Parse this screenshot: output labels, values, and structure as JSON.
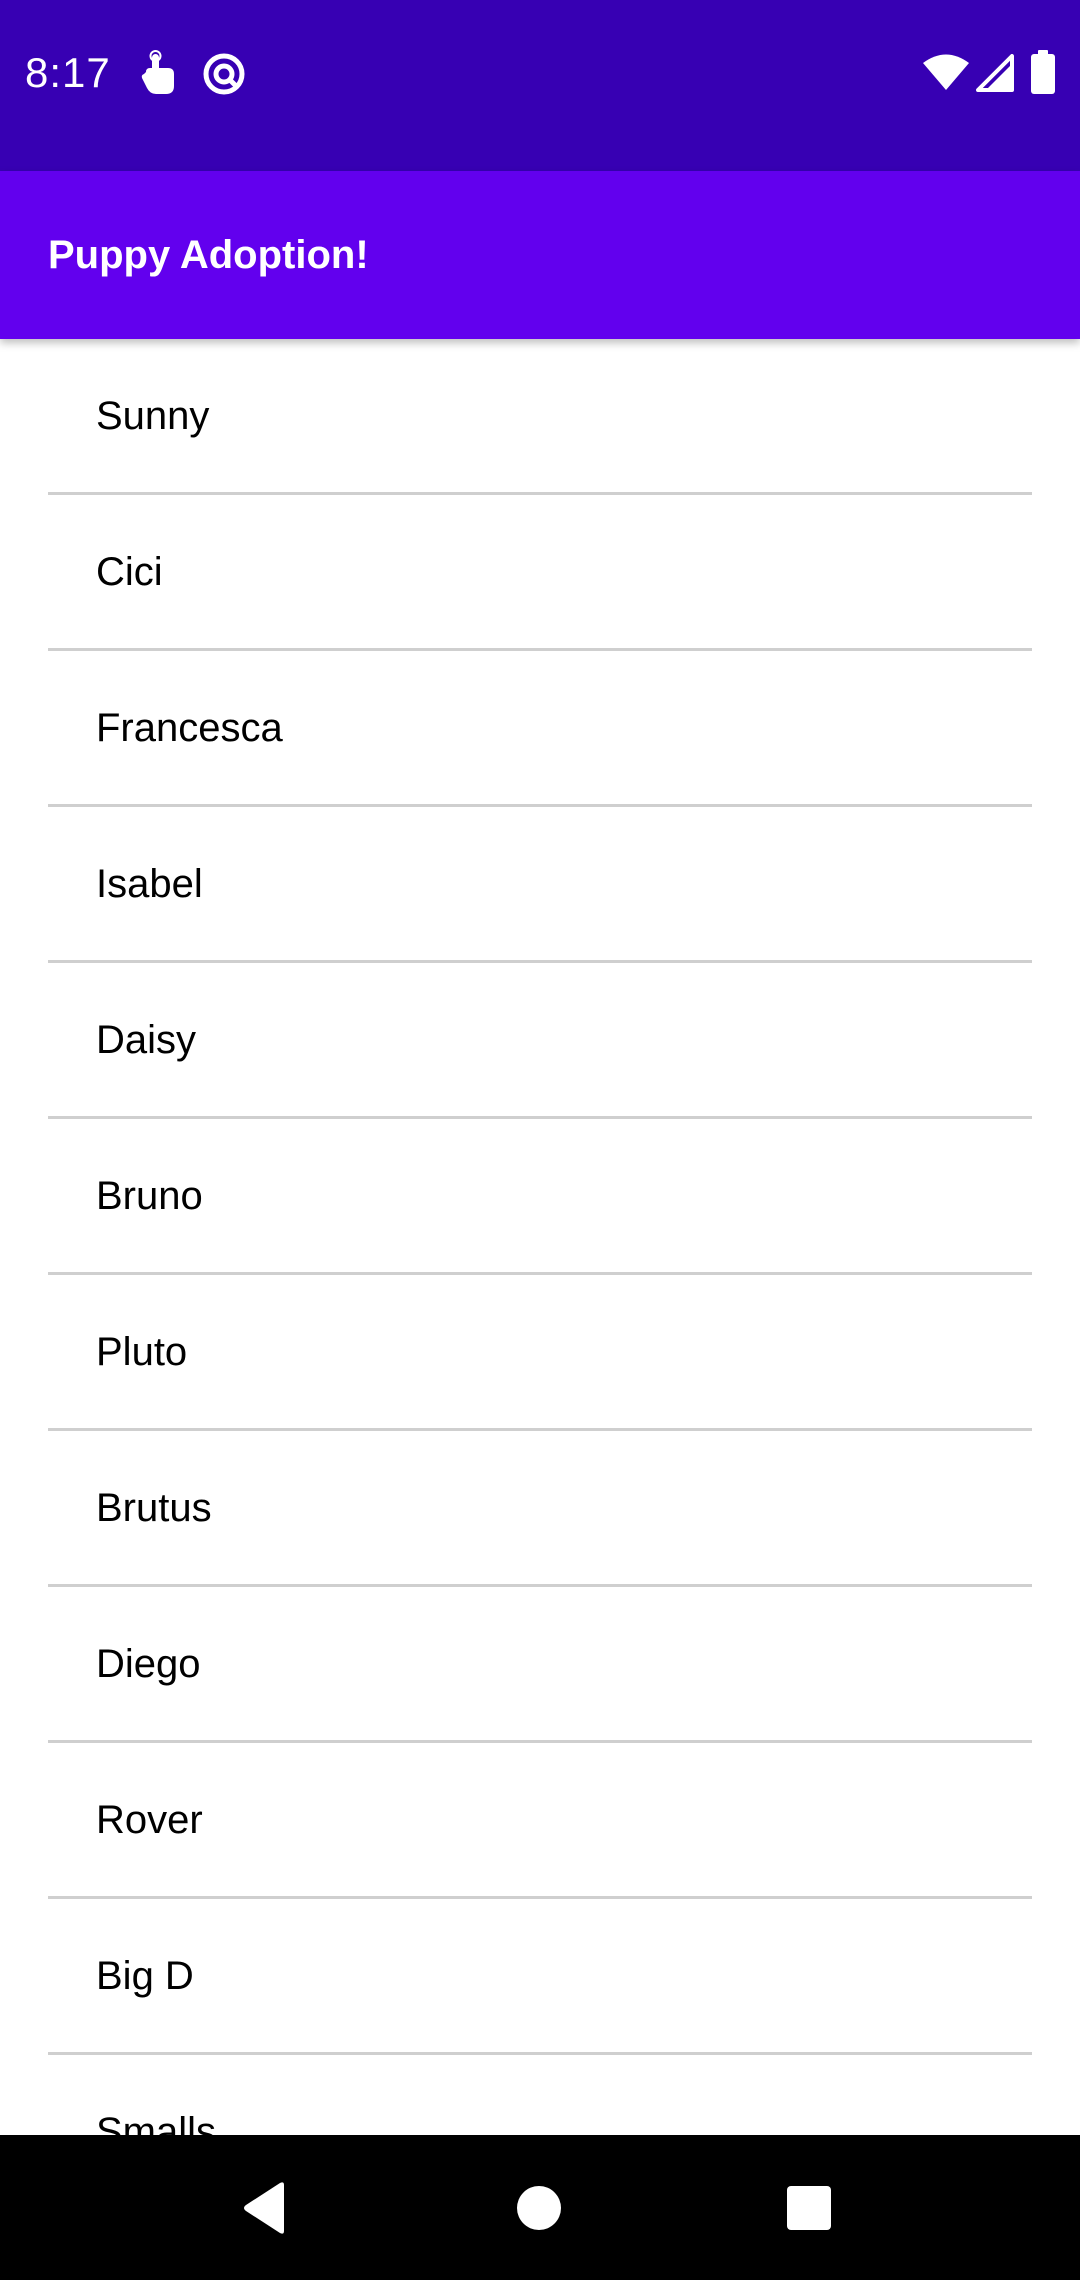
{
  "status_bar": {
    "time": "8:17",
    "icons_left": [
      "touch-icon",
      "at-sign-icon"
    ],
    "icons_right": [
      "wifi-icon",
      "signal-icon",
      "battery-icon"
    ]
  },
  "app_bar": {
    "title": "Puppy Adoption!"
  },
  "puppies": [
    {
      "name": "Sunny"
    },
    {
      "name": "Cici"
    },
    {
      "name": "Francesca"
    },
    {
      "name": "Isabel"
    },
    {
      "name": "Daisy"
    },
    {
      "name": "Bruno"
    },
    {
      "name": "Pluto"
    },
    {
      "name": "Brutus"
    },
    {
      "name": "Diego"
    },
    {
      "name": "Rover"
    },
    {
      "name": "Big D"
    },
    {
      "name": "Smalls"
    }
  ],
  "nav_bar": {
    "buttons": [
      "back-icon",
      "home-icon",
      "recents-icon"
    ]
  },
  "colors": {
    "status_bar": "#3700b3",
    "app_bar": "#6200ee",
    "divider": "#cfcfcf"
  }
}
